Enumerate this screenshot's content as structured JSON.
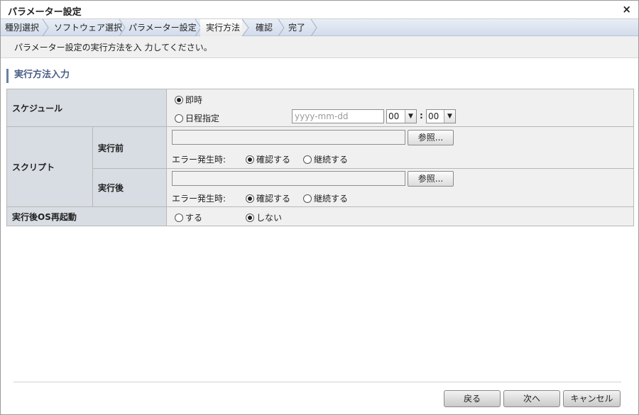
{
  "dialog": {
    "title": "パラメーター設定",
    "close_label": "×"
  },
  "steps": [
    {
      "label": "種別選択"
    },
    {
      "label": "ソフトウェア選択"
    },
    {
      "label": "パラメーター設定"
    },
    {
      "label": "実行方法",
      "active": true
    },
    {
      "label": "確認"
    },
    {
      "label": "完了"
    }
  ],
  "instruction": "パラメーター設定の実行方法を入 力してください。",
  "section_title": "実行方法入力",
  "schedule": {
    "label": "スケジュール",
    "immediate_label": "即時",
    "scheduled_label": "日程指定",
    "selected": "immediate",
    "date_placeholder": "yyyy-mm-dd",
    "hour": "00",
    "minute": "00",
    "colon": ":"
  },
  "script": {
    "label": "スクリプト",
    "before": {
      "label": "実行前",
      "browse_label": "参照...",
      "error_label": "エラー発生時:",
      "confirm_label": "確認する",
      "continue_label": "継続する",
      "selected": "confirm"
    },
    "after": {
      "label": "実行後",
      "browse_label": "参照...",
      "error_label": "エラー発生時:",
      "confirm_label": "確認する",
      "continue_label": "継続する",
      "selected": "confirm"
    }
  },
  "reboot": {
    "label": "実行後OS再起動",
    "yes_label": "する",
    "no_label": "しない",
    "selected": "no"
  },
  "footer": {
    "back_label": "戻る",
    "next_label": "次へ",
    "cancel_label": "キャンセル"
  }
}
